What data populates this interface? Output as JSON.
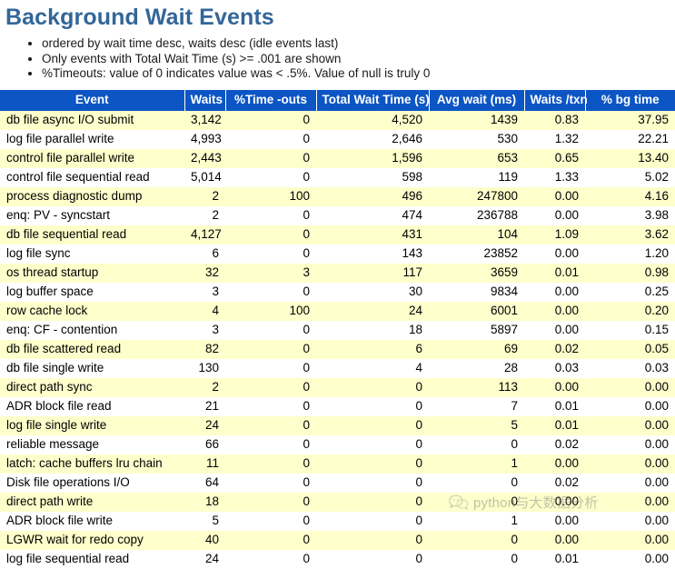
{
  "page": {
    "title": "Background Wait Events",
    "title_color": "#336699",
    "header_bg_color": "#0c55c4",
    "row_alt_color": "#ffffcc"
  },
  "notes": [
    "ordered by wait time desc, waits desc (idle events last)",
    "Only events with Total Wait Time (s) >= .001 are shown",
    "%Timeouts: value of 0 indicates value was < .5%. Value of null is truly 0"
  ],
  "table": {
    "columns": [
      "Event",
      "Waits",
      "%Time -outs",
      "Total Wait Time (s)",
      "Avg wait (ms)",
      "Waits /txn",
      "% bg time"
    ],
    "rows": [
      [
        "db file async I/O submit",
        "3,142",
        "0",
        "4,520",
        "1439",
        "0.83",
        "37.95"
      ],
      [
        "log file parallel write",
        "4,993",
        "0",
        "2,646",
        "530",
        "1.32",
        "22.21"
      ],
      [
        "control file parallel write",
        "2,443",
        "0",
        "1,596",
        "653",
        "0.65",
        "13.40"
      ],
      [
        "control file sequential read",
        "5,014",
        "0",
        "598",
        "119",
        "1.33",
        "5.02"
      ],
      [
        "process diagnostic dump",
        "2",
        "100",
        "496",
        "247800",
        "0.00",
        "4.16"
      ],
      [
        "enq: PV - syncstart",
        "2",
        "0",
        "474",
        "236788",
        "0.00",
        "3.98"
      ],
      [
        "db file sequential read",
        "4,127",
        "0",
        "431",
        "104",
        "1.09",
        "3.62"
      ],
      [
        "log file sync",
        "6",
        "0",
        "143",
        "23852",
        "0.00",
        "1.20"
      ],
      [
        "os thread startup",
        "32",
        "3",
        "117",
        "3659",
        "0.01",
        "0.98"
      ],
      [
        "log buffer space",
        "3",
        "0",
        "30",
        "9834",
        "0.00",
        "0.25"
      ],
      [
        "row cache lock",
        "4",
        "100",
        "24",
        "6001",
        "0.00",
        "0.20"
      ],
      [
        "enq: CF - contention",
        "3",
        "0",
        "18",
        "5897",
        "0.00",
        "0.15"
      ],
      [
        "db file scattered read",
        "82",
        "0",
        "6",
        "69",
        "0.02",
        "0.05"
      ],
      [
        "db file single write",
        "130",
        "0",
        "4",
        "28",
        "0.03",
        "0.03"
      ],
      [
        "direct path sync",
        "2",
        "0",
        "0",
        "113",
        "0.00",
        "0.00"
      ],
      [
        "ADR block file read",
        "21",
        "0",
        "0",
        "7",
        "0.01",
        "0.00"
      ],
      [
        "log file single write",
        "24",
        "0",
        "0",
        "5",
        "0.01",
        "0.00"
      ],
      [
        "reliable message",
        "66",
        "0",
        "0",
        "0",
        "0.02",
        "0.00"
      ],
      [
        "latch: cache buffers lru chain",
        "11",
        "0",
        "0",
        "1",
        "0.00",
        "0.00"
      ],
      [
        "Disk file operations I/O",
        "64",
        "0",
        "0",
        "0",
        "0.02",
        "0.00"
      ],
      [
        "direct path write",
        "18",
        "0",
        "0",
        "0",
        "0.00",
        "0.00"
      ],
      [
        "ADR block file write",
        "5",
        "0",
        "0",
        "1",
        "0.00",
        "0.00"
      ],
      [
        "LGWR wait for redo copy",
        "40",
        "0",
        "0",
        "0",
        "0.00",
        "0.00"
      ],
      [
        "log file sequential read",
        "24",
        "0",
        "0",
        "0",
        "0.01",
        "0.00"
      ]
    ]
  },
  "watermark": {
    "text": "python与大数据分析",
    "icon": "wechat-logo-icon"
  }
}
